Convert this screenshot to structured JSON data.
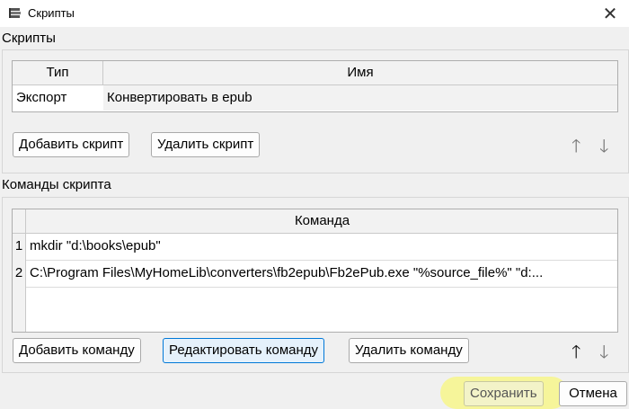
{
  "window": {
    "title": "Скрипты",
    "close_icon": "✕"
  },
  "scripts": {
    "group_label": "Скрипты",
    "columns": [
      "Тип",
      "Имя"
    ],
    "rows": [
      {
        "type": "Экспорт",
        "name": "Конвертировать в epub"
      }
    ],
    "add_label": "Добавить скрипт",
    "delete_label": "Удалить скрипт"
  },
  "commands": {
    "group_label": "Команды скрипта",
    "column": "Команда",
    "rows": [
      {
        "num": "1",
        "text": "mkdir \"d:\\books\\epub\""
      },
      {
        "num": "2",
        "text": "C:\\Program Files\\MyHomeLib\\converters\\fb2epub\\Fb2ePub.exe \"%source_file%\" \"d:..."
      }
    ],
    "add_label": "Добавить команду",
    "edit_label": "Редактировать команду",
    "delete_label": "Удалить команду"
  },
  "footer": {
    "save_label": "Сохранить",
    "cancel_label": "Отмена"
  },
  "icons": {
    "up": "🡑",
    "down": "🡓"
  },
  "colors": {
    "highlight": "#f6f59a",
    "focus_border": "#0078d7"
  }
}
